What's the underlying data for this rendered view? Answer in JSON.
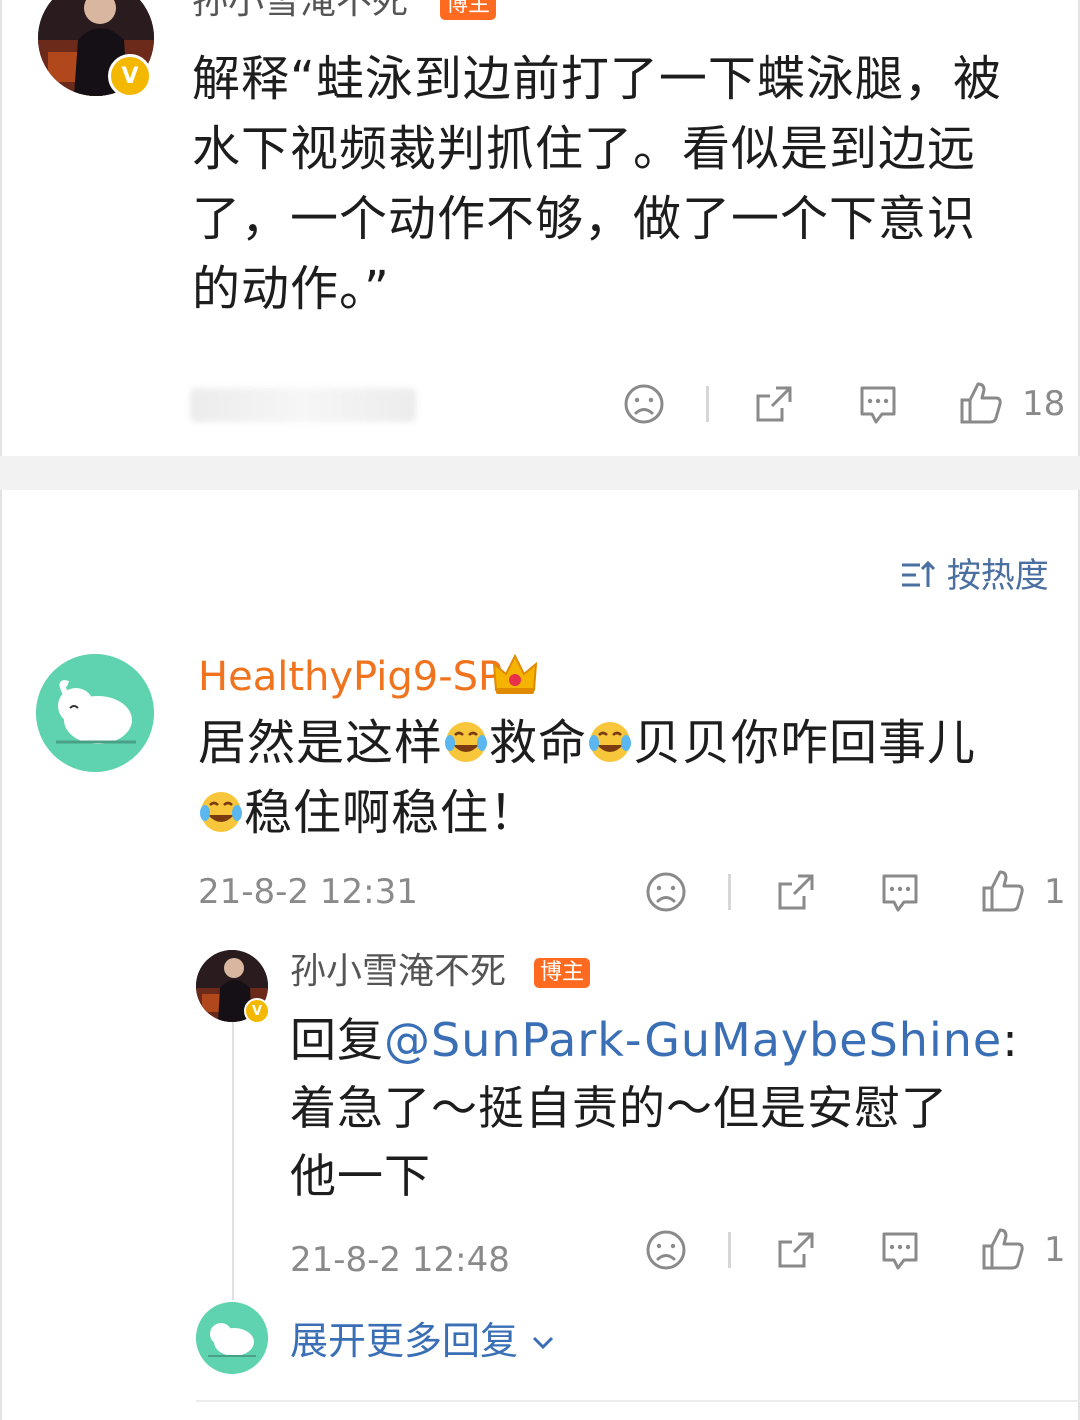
{
  "post": {
    "author": {
      "name": "孙小雪淹不死",
      "badge": "博主"
    },
    "text_part1": "解释“蛙泳到边前打了一下蝶泳腿，被",
    "text_part2": "水下视频裁判抓住了。看似是到边远",
    "text_part3": "了，一个动作不够，做了一个下意识",
    "text_part4": "的动作。”",
    "like_count": "18"
  },
  "sort": {
    "label": "按热度"
  },
  "comment": {
    "author": {
      "name": "HealthyPig9-SP"
    },
    "line1": {
      "t1": "居然是这样",
      "t2": "救命",
      "t3": "贝贝你咋回事儿"
    },
    "line2": {
      "t4": "稳住啊稳住！"
    },
    "timestamp": "21-8-2 12:31",
    "like_count": "1",
    "reply": {
      "author": {
        "name": "孙小雪淹不死",
        "badge": "博主"
      },
      "prefix": "回复",
      "mention": "@SunPark-GuMaybeShine",
      "colon": ":",
      "line2": "着急了～挺自责的～但是安慰了",
      "line3": "他一下",
      "timestamp": "21-8-2 12:48",
      "like_count": "1"
    },
    "expand_label": "展开更多回复"
  },
  "icons": {
    "dislike": "sad-face-icon",
    "share": "share-icon",
    "comment": "comment-bubble-icon",
    "like": "thumbs-up-icon",
    "verified": "verified-v-icon",
    "crown": "crown-icon",
    "sort": "sort-icon",
    "chevron": "chevron-down-icon"
  },
  "colors": {
    "accent_blue": "#3a6fb6",
    "vip_orange": "#f0731e",
    "badge_orange": "#ff6a21",
    "verified_yellow": "#f5b800",
    "meta_gray": "#8a8a8a"
  }
}
